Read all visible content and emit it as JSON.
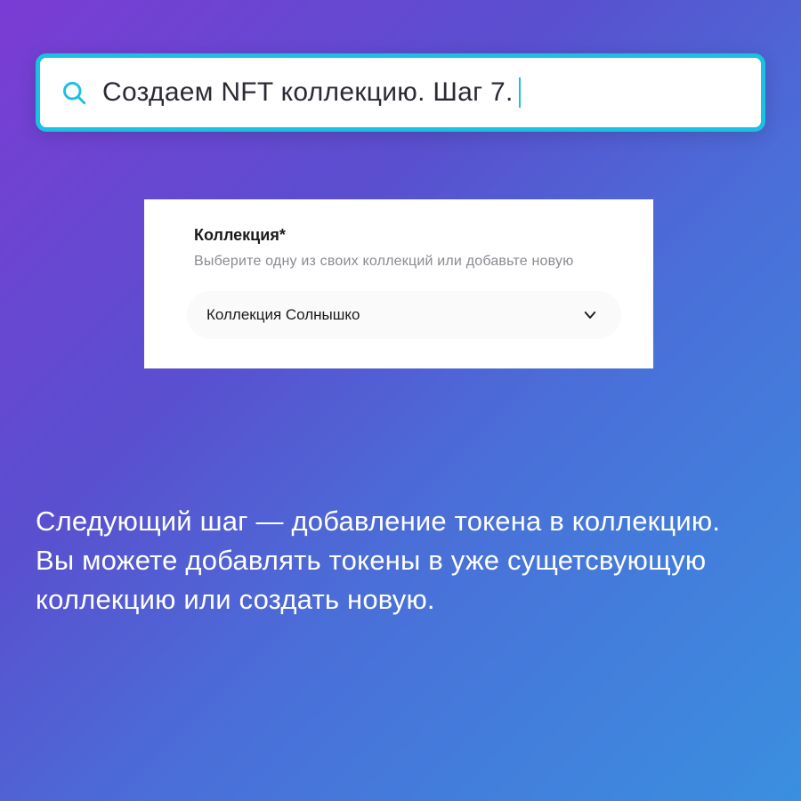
{
  "search": {
    "text": "Создаем NFT коллекцию. Шаг 7."
  },
  "card": {
    "title": "Коллекция*",
    "subtitle": "Выберите одну из своих коллекций или добавьте новую",
    "dropdown_value": "Коллекция Солнышко"
  },
  "description": "Следующий шаг — добавление токена в коллекцию. Вы можете добавлять токены в уже сущетсвующую коллекцию или создать новую."
}
